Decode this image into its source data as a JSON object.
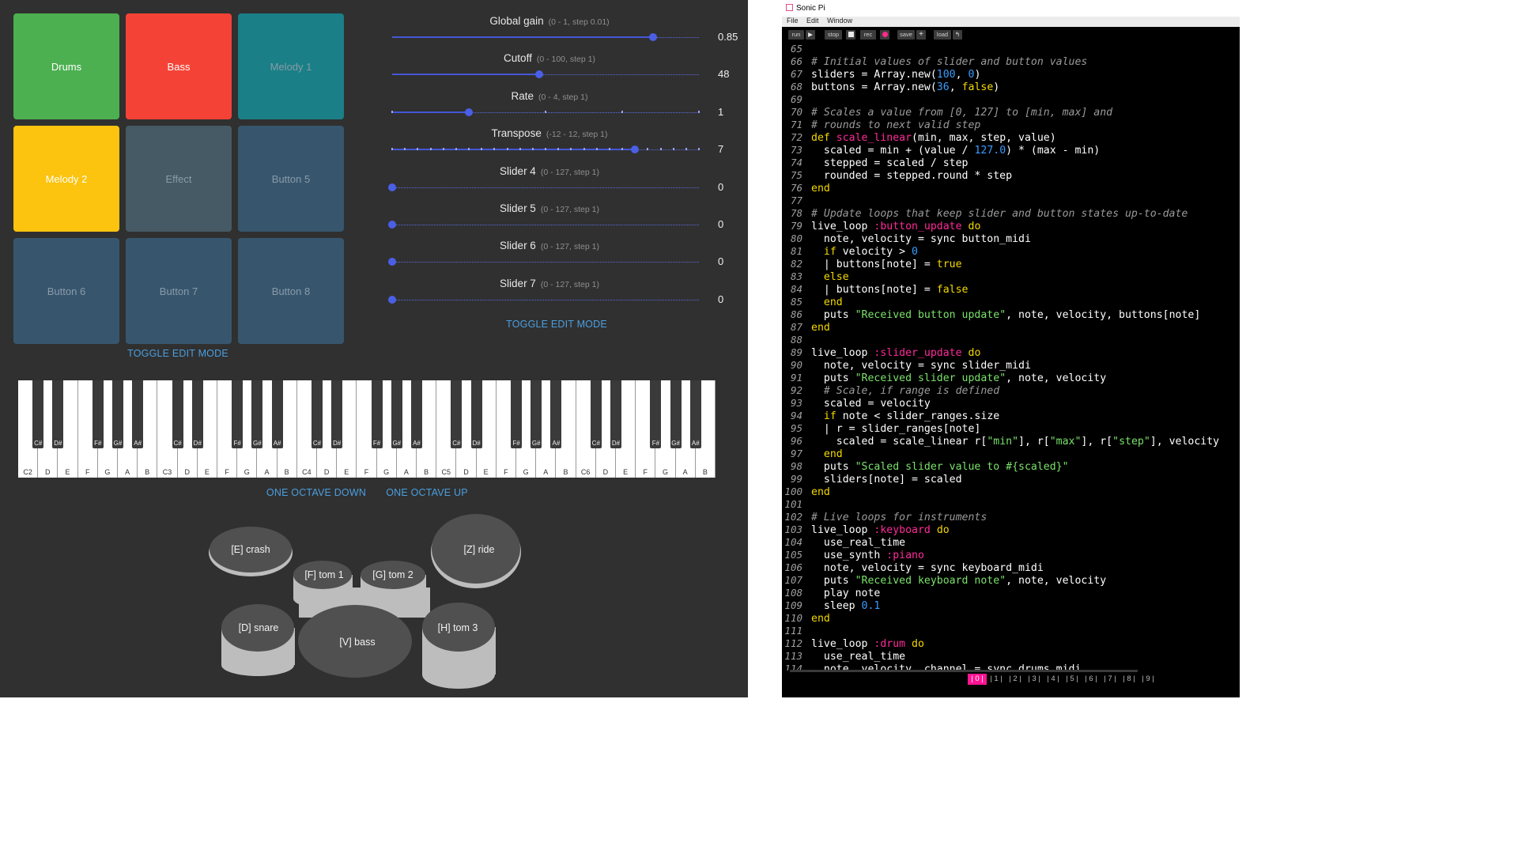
{
  "pads": {
    "toggle_label": "TOGGLE EDIT MODE",
    "items": [
      {
        "label": "Drums",
        "color": "#4caf50",
        "active": true
      },
      {
        "label": "Bass",
        "color": "#f44336",
        "active": true
      },
      {
        "label": "Melody 1",
        "color": "#1a7f86",
        "active": false
      },
      {
        "label": "Melody 2",
        "color": "#fcc30f",
        "active": true
      },
      {
        "label": "Effect",
        "color": "#455a64",
        "active": false
      },
      {
        "label": "Button 5",
        "color": "#37566e",
        "active": false
      },
      {
        "label": "Button 6",
        "color": "#37566e",
        "active": false
      },
      {
        "label": "Button 7",
        "color": "#37566e",
        "active": false
      },
      {
        "label": "Button 8",
        "color": "#37566e",
        "active": false
      }
    ]
  },
  "sliders": {
    "toggle_label": "TOGGLE EDIT MODE",
    "items": [
      {
        "title": "Global gain",
        "hint": "(0 - 1, step 0.01)",
        "value": "0.85",
        "fraction": 0.85,
        "stepped": false
      },
      {
        "title": "Cutoff",
        "hint": "(0 - 100, step 1)",
        "value": "48",
        "fraction": 0.48,
        "stepped": false
      },
      {
        "title": "Rate",
        "hint": "(0 - 4, step 1)",
        "value": "1",
        "fraction": 0.25,
        "stepped": true
      },
      {
        "title": "Transpose",
        "hint": "(-12 - 12, step 1)",
        "value": "7",
        "fraction": 0.79,
        "stepped": true
      },
      {
        "title": "Slider 4",
        "hint": "(0 - 127, step 1)",
        "value": "0",
        "fraction": 0,
        "stepped": false
      },
      {
        "title": "Slider 5",
        "hint": "(0 - 127, step 1)",
        "value": "0",
        "fraction": 0,
        "stepped": false
      },
      {
        "title": "Slider 6",
        "hint": "(0 - 127, step 1)",
        "value": "0",
        "fraction": 0,
        "stepped": false
      },
      {
        "title": "Slider 7",
        "hint": "(0 - 127, step 1)",
        "value": "0",
        "fraction": 0,
        "stepped": false
      }
    ]
  },
  "keyboard": {
    "white_keys": [
      "C2",
      "D",
      "E",
      "F",
      "G",
      "A",
      "B",
      "C3",
      "D",
      "E",
      "F",
      "G",
      "A",
      "B",
      "C4",
      "D",
      "E",
      "F",
      "G",
      "A",
      "B",
      "C5",
      "D",
      "E",
      "F",
      "G",
      "A",
      "B",
      "C6",
      "D",
      "E",
      "F",
      "G",
      "A",
      "B"
    ],
    "black_keys_per_octave": [
      "C#",
      "D#",
      "",
      "F#",
      "G#",
      "A#"
    ],
    "octave_down_label": "ONE OCTAVE DOWN",
    "octave_up_label": "ONE OCTAVE UP"
  },
  "drums": {
    "crash": "[E] crash",
    "tom1": "[F] tom 1",
    "tom2": "[G] tom 2",
    "ride": "[Z] ride",
    "snare": "[D] snare",
    "bass": "[V] bass",
    "tom3": "[H] tom 3"
  },
  "sonicpi": {
    "window_title": "Sonic Pi",
    "menu": [
      "File",
      "Edit",
      "Window"
    ],
    "toolbar": {
      "run": "run",
      "stop": "stop",
      "rec": "rec",
      "save": "save",
      "load": "load"
    },
    "buffers": [
      "| 0 |",
      "| 1 |",
      "| 2 |",
      "| 3 |",
      "| 4 |",
      "| 5 |",
      "| 6 |",
      "| 7 |",
      "| 8 |",
      "| 9 |"
    ],
    "selected_buffer": 0,
    "code_lines": [
      {
        "n": "65",
        "seg": []
      },
      {
        "n": "66",
        "seg": [
          [
            "com",
            "# Initial values of slider and button values"
          ]
        ]
      },
      {
        "n": "67",
        "seg": [
          [
            "",
            "sliders = Array.new("
          ],
          [
            "num",
            "100"
          ],
          [
            "",
            ", "
          ],
          [
            "num",
            "0"
          ],
          [
            "",
            ")"
          ]
        ]
      },
      {
        "n": "68",
        "seg": [
          [
            "",
            "buttons = Array.new("
          ],
          [
            "num",
            "36"
          ],
          [
            "",
            ", "
          ],
          [
            "bool",
            "false"
          ],
          [
            "",
            ")"
          ]
        ]
      },
      {
        "n": "69",
        "seg": []
      },
      {
        "n": "70",
        "seg": [
          [
            "com",
            "# Scales a value from [0, 127] to [min, max] and"
          ]
        ]
      },
      {
        "n": "71",
        "seg": [
          [
            "com",
            "# rounds to next valid step"
          ]
        ]
      },
      {
        "n": "72",
        "seg": [
          [
            "kw",
            "def "
          ],
          [
            "sym",
            "scale_linear"
          ],
          [
            "",
            "(min, max, step, value)"
          ]
        ]
      },
      {
        "n": "73",
        "seg": [
          [
            "",
            "  scaled = min + (value / "
          ],
          [
            "num",
            "127.0"
          ],
          [
            "",
            ") * (max - min)"
          ]
        ]
      },
      {
        "n": "74",
        "seg": [
          [
            "",
            "  stepped = scaled / step"
          ]
        ]
      },
      {
        "n": "75",
        "seg": [
          [
            "",
            "  rounded = stepped.round * step"
          ]
        ]
      },
      {
        "n": "76",
        "seg": [
          [
            "kw",
            "end"
          ]
        ]
      },
      {
        "n": "77",
        "seg": []
      },
      {
        "n": "78",
        "seg": [
          [
            "com",
            "# Update loops that keep slider and button states up-to-date"
          ]
        ]
      },
      {
        "n": "79",
        "seg": [
          [
            "",
            "live_loop "
          ],
          [
            "sym",
            ":button_update"
          ],
          [
            "kw",
            " do"
          ]
        ]
      },
      {
        "n": "80",
        "seg": [
          [
            "",
            "  note, velocity = sync button_midi"
          ]
        ]
      },
      {
        "n": "81",
        "seg": [
          [
            "kw",
            "  if"
          ],
          [
            "",
            " velocity > "
          ],
          [
            "num",
            "0"
          ]
        ]
      },
      {
        "n": "82",
        "seg": [
          [
            "",
            "  | buttons[note] = "
          ],
          [
            "bool",
            "true"
          ]
        ]
      },
      {
        "n": "83",
        "seg": [
          [
            "kw",
            "  else"
          ]
        ]
      },
      {
        "n": "84",
        "seg": [
          [
            "",
            "  | buttons[note] = "
          ],
          [
            "bool",
            "false"
          ]
        ]
      },
      {
        "n": "85",
        "seg": [
          [
            "kw",
            "  end"
          ]
        ]
      },
      {
        "n": "86",
        "seg": [
          [
            "",
            "  puts "
          ],
          [
            "str",
            "\"Received button update\""
          ],
          [
            "",
            ", note, velocity, buttons[note]"
          ]
        ]
      },
      {
        "n": "87",
        "seg": [
          [
            "kw",
            "end"
          ]
        ]
      },
      {
        "n": "88",
        "seg": []
      },
      {
        "n": "89",
        "seg": [
          [
            "",
            "live_loop "
          ],
          [
            "sym",
            ":slider_update"
          ],
          [
            "kw",
            " do"
          ]
        ]
      },
      {
        "n": "90",
        "seg": [
          [
            "",
            "  note, velocity = sync slider_midi"
          ]
        ]
      },
      {
        "n": "91",
        "seg": [
          [
            "",
            "  puts "
          ],
          [
            "str",
            "\"Received slider update\""
          ],
          [
            "",
            ", note, velocity"
          ]
        ]
      },
      {
        "n": "92",
        "seg": [
          [
            "com",
            "  # Scale, if range is defined"
          ]
        ]
      },
      {
        "n": "93",
        "seg": [
          [
            "",
            "  scaled = velocity"
          ]
        ]
      },
      {
        "n": "94",
        "seg": [
          [
            "kw",
            "  if"
          ],
          [
            "",
            " note < slider_ranges.size"
          ]
        ]
      },
      {
        "n": "95",
        "seg": [
          [
            "",
            "  | r = slider_ranges[note]"
          ]
        ]
      },
      {
        "n": "96",
        "seg": [
          [
            "",
            "    scaled = scale_linear r["
          ],
          [
            "str",
            "\"min\""
          ],
          [
            "",
            "], r["
          ],
          [
            "str",
            "\"max\""
          ],
          [
            "",
            "], r["
          ],
          [
            "str",
            "\"step\""
          ],
          [
            "",
            "], velocity"
          ]
        ]
      },
      {
        "n": "97",
        "seg": [
          [
            "kw",
            "  end"
          ]
        ]
      },
      {
        "n": "98",
        "seg": [
          [
            "",
            "  puts "
          ],
          [
            "str",
            "\"Scaled slider value to #{scaled}\""
          ]
        ]
      },
      {
        "n": "99",
        "seg": [
          [
            "",
            "  sliders[note] = scaled"
          ]
        ]
      },
      {
        "n": "100",
        "seg": [
          [
            "kw",
            "end"
          ]
        ]
      },
      {
        "n": "101",
        "seg": []
      },
      {
        "n": "102",
        "seg": [
          [
            "com",
            "# Live loops for instruments"
          ]
        ]
      },
      {
        "n": "103",
        "seg": [
          [
            "",
            "live_loop "
          ],
          [
            "sym",
            ":keyboard"
          ],
          [
            "kw",
            " do"
          ]
        ]
      },
      {
        "n": "104",
        "seg": [
          [
            "",
            "  use_real_time"
          ]
        ]
      },
      {
        "n": "105",
        "seg": [
          [
            "",
            "  use_synth "
          ],
          [
            "sym",
            ":piano"
          ]
        ]
      },
      {
        "n": "106",
        "seg": [
          [
            "",
            "  note, velocity = sync keyboard_midi"
          ]
        ]
      },
      {
        "n": "107",
        "seg": [
          [
            "",
            "  puts "
          ],
          [
            "str",
            "\"Received keyboard note\""
          ],
          [
            "",
            ", note, velocity"
          ]
        ]
      },
      {
        "n": "108",
        "seg": [
          [
            "",
            "  play note"
          ]
        ]
      },
      {
        "n": "109",
        "seg": [
          [
            "",
            "  sleep "
          ],
          [
            "num",
            "0.1"
          ]
        ]
      },
      {
        "n": "110",
        "seg": [
          [
            "kw",
            "end"
          ]
        ]
      },
      {
        "n": "111",
        "seg": []
      },
      {
        "n": "112",
        "seg": [
          [
            "",
            "live_loop "
          ],
          [
            "sym",
            ":drum"
          ],
          [
            "kw",
            " do"
          ]
        ]
      },
      {
        "n": "113",
        "seg": [
          [
            "",
            "  use_real_time"
          ]
        ]
      },
      {
        "n": "114",
        "seg": [
          [
            "",
            "  note, velocity, channel = sync drums_midi"
          ]
        ]
      }
    ]
  }
}
